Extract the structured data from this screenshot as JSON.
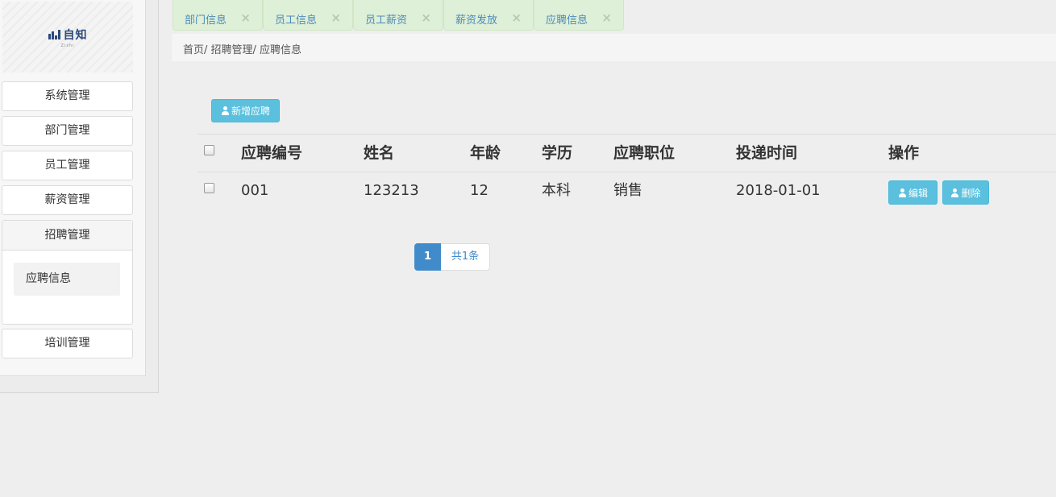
{
  "sidebar": {
    "logo_text": "自知",
    "logo_sub": "Zizhi",
    "menu": [
      {
        "label": "系统管理"
      },
      {
        "label": "部门管理"
      },
      {
        "label": "员工管理"
      },
      {
        "label": "薪资管理"
      },
      {
        "label": "招聘管理"
      },
      {
        "label": "培训管理"
      }
    ],
    "submenu": [
      {
        "label": "应聘信息"
      }
    ]
  },
  "tabs": [
    {
      "label": "部门信息"
    },
    {
      "label": "员工信息"
    },
    {
      "label": "员工薪资"
    },
    {
      "label": "薪资发放"
    },
    {
      "label": "应聘信息"
    }
  ],
  "tab_close_glyph": "×",
  "breadcrumb": "首页/ 招聘管理/ 应聘信息",
  "toolbar": {
    "add_label": "新增应聘"
  },
  "table": {
    "headers": [
      "应聘编号",
      "姓名",
      "年龄",
      "学历",
      "应聘职位",
      "投递时间",
      "操作"
    ],
    "rows": [
      {
        "id": "001",
        "name": "123213",
        "age": "12",
        "education": "本科",
        "position": "销售",
        "date": "2018-01-01",
        "edit_label": "编辑",
        "delete_label": "删除"
      }
    ]
  },
  "pagination": {
    "current": "1",
    "total": "共1条"
  },
  "colors": {
    "accent": "#5bc0de",
    "primary": "#428bca",
    "tab_bg": "#dff0d8"
  }
}
